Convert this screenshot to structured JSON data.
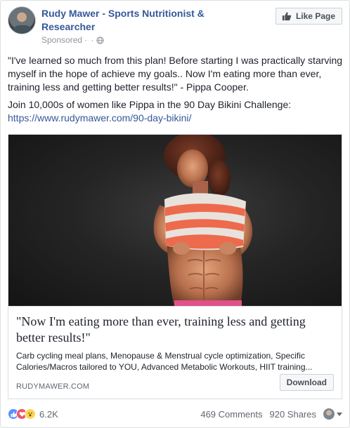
{
  "post": {
    "page_name": "Rudy Mawer - Sports Nutritionist & Researcher",
    "sponsored_label": "Sponsored",
    "sponsored_separator": "· ·",
    "like_page_label": "Like Page",
    "body_quote": "\"I've learned so much from this plan! Before starting I was practically starving myself in the hope of achieve my goals.. Now I'm eating more than ever, training less and getting better results!\" - Pippa Cooper.",
    "body_cta": "Join 10,000s of women like Pippa in the 90 Day Bikini Challenge:",
    "body_link": "https://www.rudymawer.com/90-day-bikini/"
  },
  "card": {
    "title": "\"Now I'm eating more than ever, training less and getting better results!\"",
    "description": "Carb cycling meal plans, Menopause & Menstrual cycle optimization, Specific Calories/Macros tailored to YOU, Advanced Metabolic Workouts, HIIT training...",
    "domain": "RUDYMAWER.COM",
    "button_label": "Download"
  },
  "footer": {
    "reactions": [
      "like-icon",
      "love-icon",
      "wow-icon"
    ],
    "reaction_count": "6.2K",
    "comments": "469 Comments",
    "shares": "920 Shares"
  },
  "colors": {
    "link": "#365899",
    "like_blue": "#5890ff",
    "love_red": "#f25268",
    "wow_yellow": "#fcd654"
  }
}
